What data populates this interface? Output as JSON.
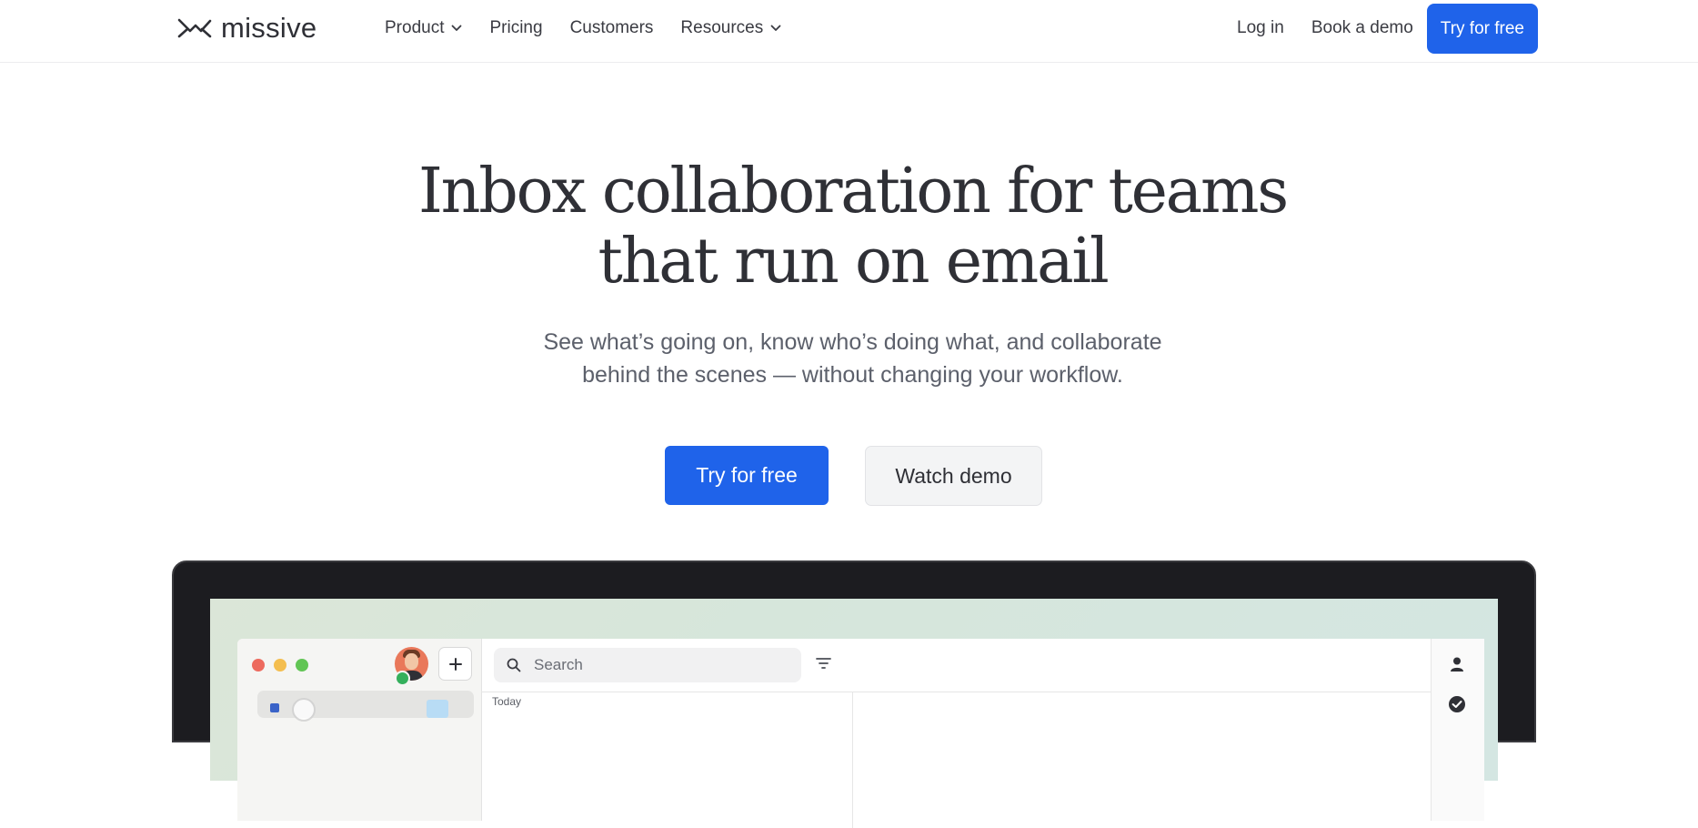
{
  "brand": {
    "name": "missive",
    "icon": "missive-logo-icon"
  },
  "nav": {
    "items": [
      {
        "label": "Product",
        "has_dropdown": true
      },
      {
        "label": "Pricing",
        "has_dropdown": false
      },
      {
        "label": "Customers",
        "has_dropdown": false
      },
      {
        "label": "Resources",
        "has_dropdown": true
      }
    ],
    "login": "Log in",
    "book_demo": "Book a demo",
    "cta": "Try for free"
  },
  "hero": {
    "title_line1": "Inbox collaboration for teams",
    "title_line2": "that run on email",
    "subtitle_line1": "See what’s going on, know who’s doing what, and collaborate",
    "subtitle_line2": "behind the scenes — without changing your workflow.",
    "primary_cta": "Try for free",
    "secondary_cta": "Watch demo"
  },
  "app_preview": {
    "search_placeholder": "Search",
    "section_label": "Today",
    "window_controls": [
      "close",
      "minimize",
      "maximize"
    ],
    "icons": [
      "search-icon",
      "filter-icon",
      "person-icon",
      "check-circle-icon",
      "plus-icon"
    ]
  },
  "colors": {
    "accent": "#1f63ea",
    "text": "#2f3036",
    "muted": "#5c606b",
    "traffic_red": "#ed6a5e",
    "traffic_yellow": "#f4be4f",
    "traffic_green": "#61c554",
    "presence": "#34b05c"
  }
}
